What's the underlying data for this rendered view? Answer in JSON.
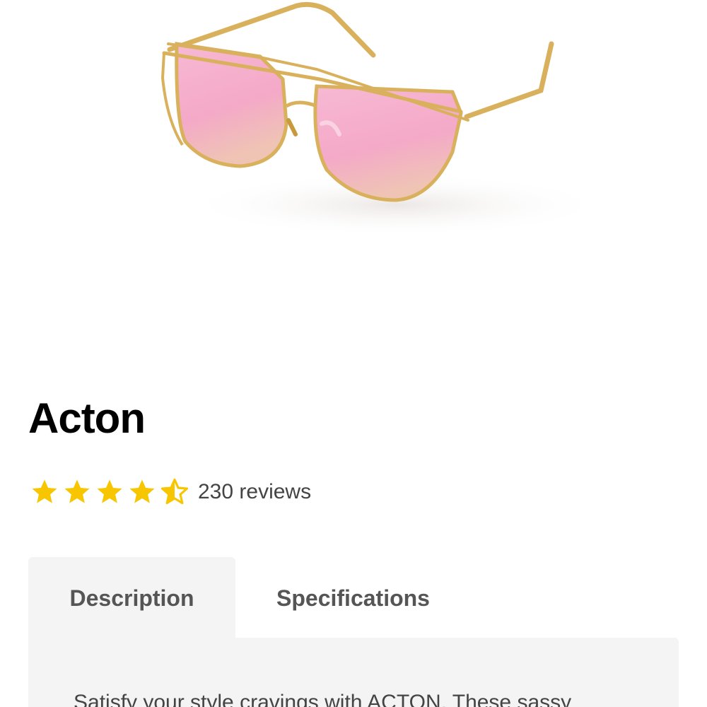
{
  "product": {
    "title": "Acton",
    "rating": 4.5,
    "rating_max": 5,
    "reviews_text": "230 reviews",
    "image_icon": "sunglasses-image"
  },
  "tabs": [
    {
      "label": "Description",
      "active": true
    },
    {
      "label": "Specifications",
      "active": false
    }
  ],
  "description": {
    "text": "Satisfy your style cravings with ACTON. These sassy"
  },
  "colors": {
    "star": "#f7c600",
    "lens_pink": "#f6b6d0",
    "frame_gold": "#d9b15c",
    "tab_bg": "#f4f4f4"
  }
}
